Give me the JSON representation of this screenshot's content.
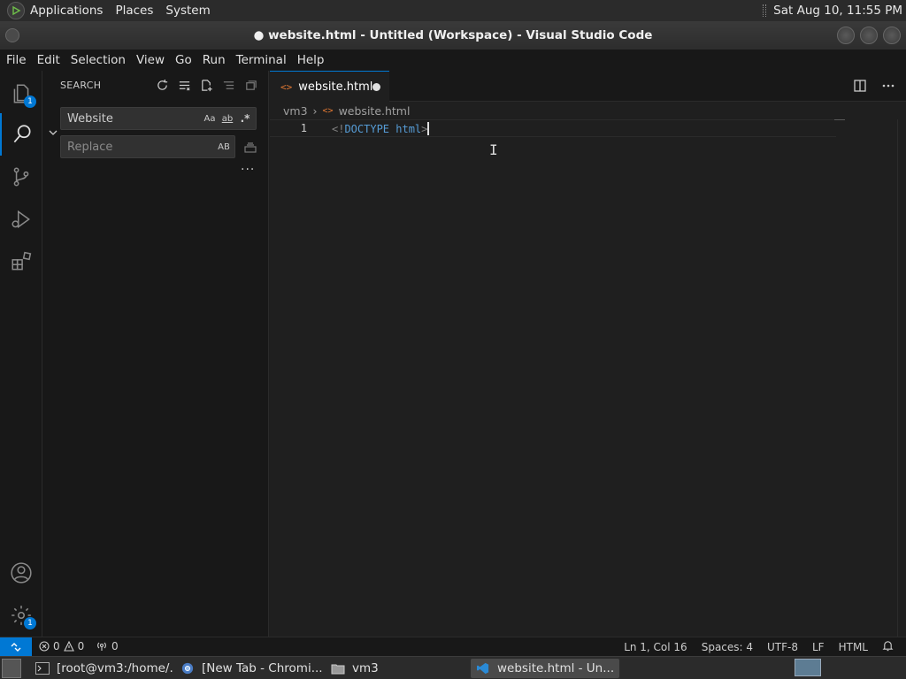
{
  "system_panel": {
    "menus": [
      "Applications",
      "Places",
      "System"
    ],
    "clock": "Sat Aug 10, 11:55 PM"
  },
  "window": {
    "title": "● website.html - Untitled (Workspace) - Visual Studio Code"
  },
  "menubar": [
    "File",
    "Edit",
    "Selection",
    "View",
    "Go",
    "Run",
    "Terminal",
    "Help"
  ],
  "activity_bar": {
    "explorer_badge": "1",
    "settings_badge": "1"
  },
  "sidebar": {
    "title": "SEARCH",
    "search_value": "Website",
    "replace_placeholder": "Replace",
    "opt_case": "Aa",
    "opt_word": "ab",
    "opt_regex": ".*",
    "opt_preserve_case": "AB",
    "more": "..."
  },
  "editor": {
    "tab_label": "website.html",
    "breadcrumb": [
      "vm3",
      "website.html"
    ],
    "line_number": "1",
    "code_open": "<!",
    "code_tag": "DOCTYPE html",
    "code_close": ">"
  },
  "statusbar": {
    "errors": "0",
    "warnings": "0",
    "ports": "0",
    "position": "Ln 1, Col 16",
    "spaces": "Spaces: 4",
    "encoding": "UTF-8",
    "eol": "LF",
    "language": "HTML"
  },
  "taskbar": {
    "items": [
      "[root@vm3:/home/...",
      "[New Tab - Chromi...",
      "vm3",
      "website.html - Un..."
    ]
  },
  "colors": {
    "accent": "#0078d4",
    "html_icon": "#e37933"
  }
}
